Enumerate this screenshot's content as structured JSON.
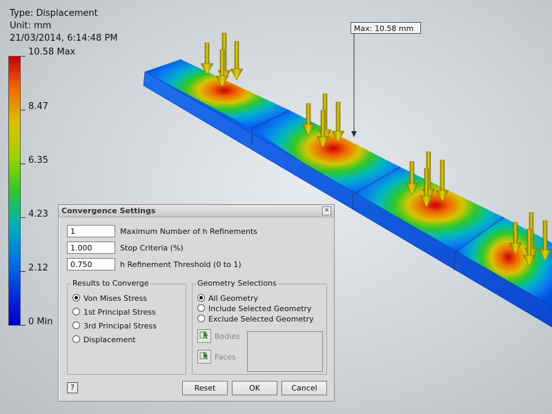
{
  "result_info": {
    "type": "Type: Displacement",
    "unit": "Unit: mm",
    "timestamp": "21/03/2014, 6:14:48 PM"
  },
  "legend": {
    "labels": [
      "10.58 Max",
      "8.47",
      "6.35",
      "4.23",
      "2.12",
      "0 Min"
    ]
  },
  "callout": {
    "text": "Max: 10.58 mm"
  },
  "dialog": {
    "title": "Convergence Settings",
    "close_glyph": "×",
    "fields": [
      {
        "value": "1",
        "label": "Maximum Number of h Refinements"
      },
      {
        "value": "1.000",
        "label": "Stop Criteria (%)"
      },
      {
        "value": "0.750",
        "label": "h Refinement Threshold (0 to 1)"
      }
    ],
    "results_group": {
      "title": "Results to Converge",
      "options": [
        "Von Mises Stress",
        "1st Principal Stress",
        "3rd Principal Stress",
        "Displacement"
      ],
      "selected": "Von Mises Stress"
    },
    "geometry_group": {
      "title": "Geometry Selections",
      "options": [
        "All Geometry",
        "Include Selected Geometry",
        "Exclude Selected Geometry"
      ],
      "selected": "All Geometry",
      "bodies_label": "Bodies",
      "faces_label": "Faces"
    },
    "help_glyph": "?",
    "buttons": {
      "reset": "Reset",
      "ok": "OK",
      "cancel": "Cancel"
    }
  },
  "colors": {
    "max": "#c8000a",
    "min": "#0000c8",
    "arrow": "#c8b400",
    "dialog_bg": "#d9d9d9"
  }
}
